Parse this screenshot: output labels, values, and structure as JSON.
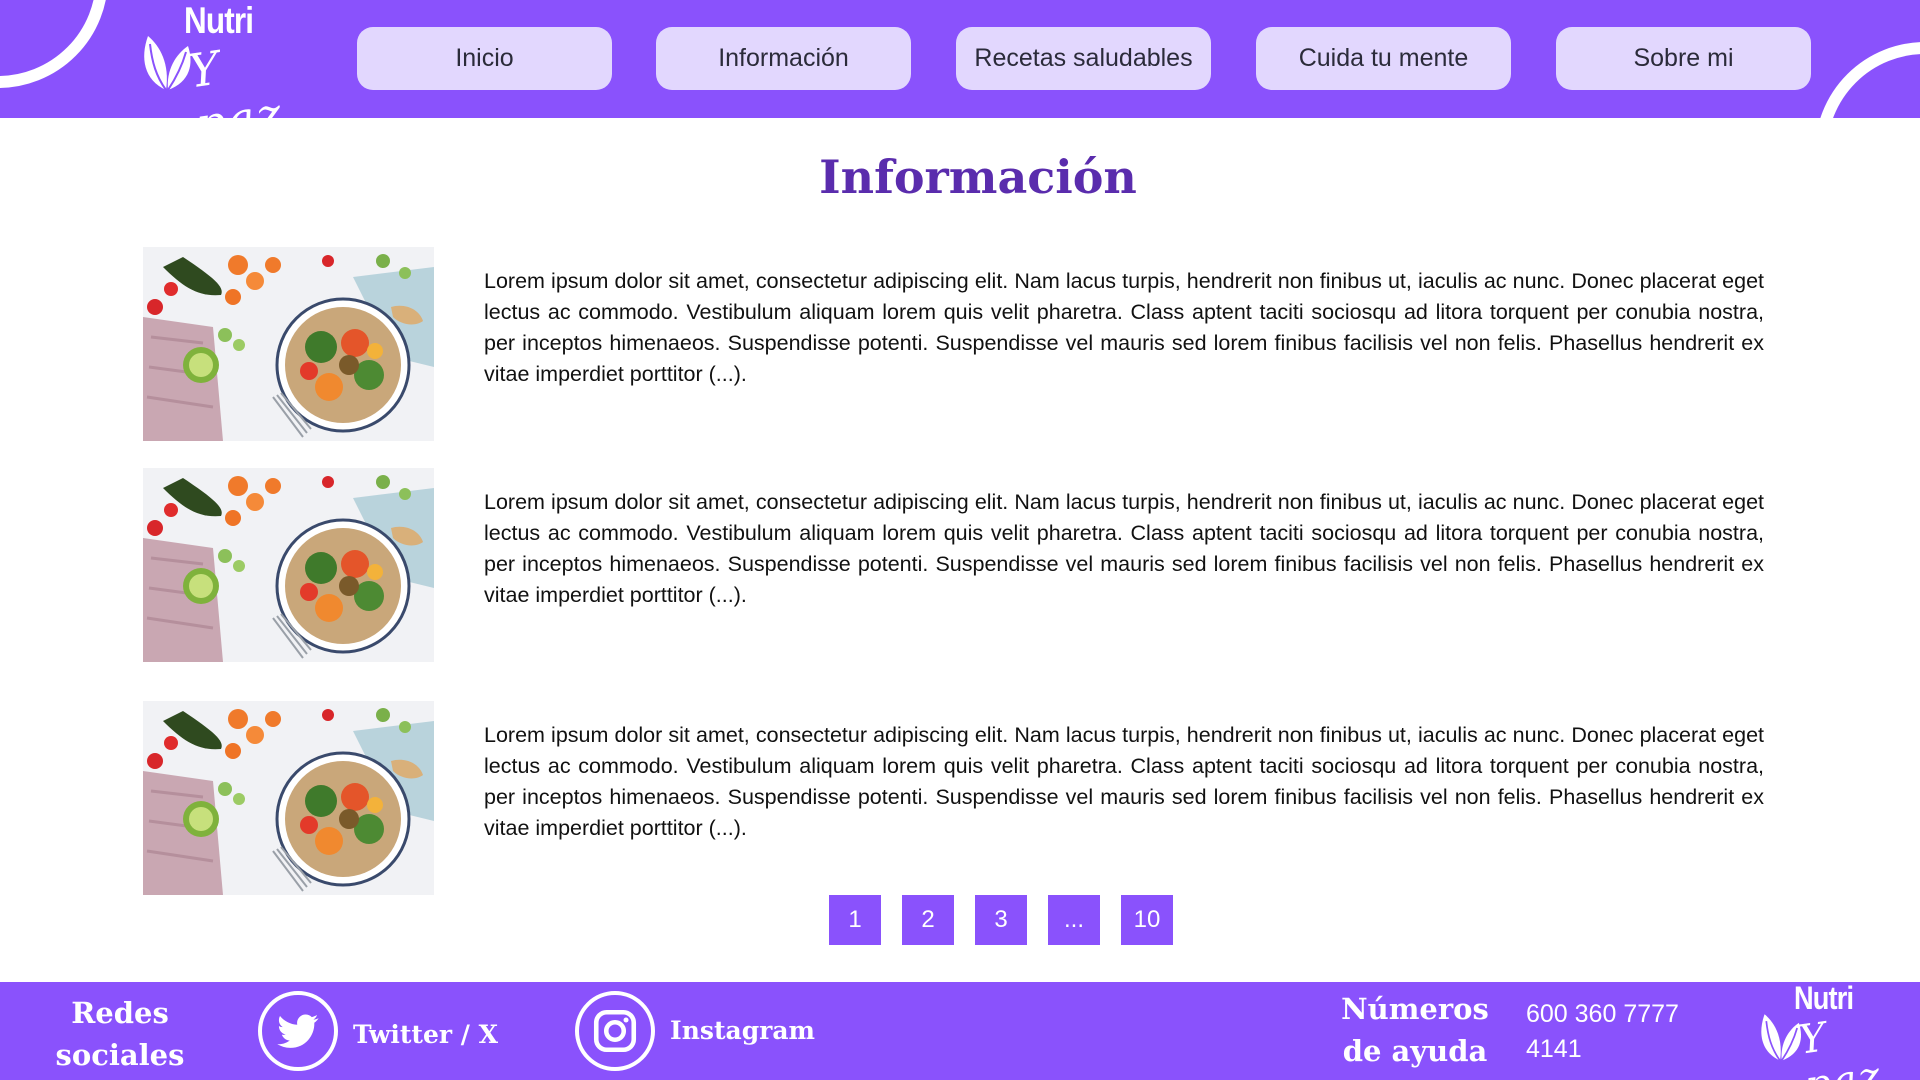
{
  "brand": {
    "name_top": "Nutri",
    "name_script": "Y paz",
    "accent": "#8a52fc",
    "nav_bg": "#e2d7fe",
    "title_color": "#5a2cad"
  },
  "nav": {
    "items": [
      {
        "label": "Inicio"
      },
      {
        "label": "Información"
      },
      {
        "label": "Recetas saludables"
      },
      {
        "label": "Cuida tu mente"
      },
      {
        "label": "Sobre mi"
      }
    ]
  },
  "main": {
    "title": "Información",
    "articles": [
      {
        "image": "healthy-food-bowl-photo",
        "text": "Lorem ipsum dolor sit amet, consectetur adipiscing elit. Nam lacus turpis, hendrerit non finibus ut, iaculis ac nunc. Donec placerat eget lectus ac commodo. Vestibulum aliquam lorem quis velit pharetra. Class aptent taciti sociosqu ad litora torquent per conubia nostra, per inceptos himenaeos. Suspendisse potenti. Suspendisse vel mauris sed lorem finibus facilisis vel non felis. Phasellus hendrerit ex vitae imperdiet porttitor (...)."
      },
      {
        "image": "healthy-food-bowl-photo",
        "text": "Lorem ipsum dolor sit amet, consectetur adipiscing elit. Nam lacus turpis, hendrerit non finibus ut, iaculis ac nunc. Donec placerat eget lectus ac commodo. Vestibulum aliquam lorem quis velit pharetra. Class aptent taciti sociosqu ad litora torquent per conubia nostra, per inceptos himenaeos. Suspendisse potenti. Suspendisse vel mauris sed lorem finibus facilisis vel non felis. Phasellus hendrerit ex vitae imperdiet porttitor (...)."
      },
      {
        "image": "healthy-food-bowl-photo",
        "text": "Lorem ipsum dolor sit amet, consectetur adipiscing elit. Nam lacus turpis, hendrerit non finibus ut, iaculis ac nunc. Donec placerat eget lectus ac commodo. Vestibulum aliquam lorem quis velit pharetra. Class aptent taciti sociosqu ad litora torquent per conubia nostra, per inceptos himenaeos. Suspendisse potenti. Suspendisse vel mauris sed lorem finibus facilisis vel non felis. Phasellus hendrerit ex vitae imperdiet porttitor (...)."
      }
    ],
    "pagination": [
      "1",
      "2",
      "3",
      "...",
      "10"
    ]
  },
  "footer": {
    "social_title": "Redes sociales",
    "twitter": {
      "icon": "twitter-bird-icon",
      "label": "Twitter / X"
    },
    "instagram": {
      "icon": "instagram-icon",
      "label": "Instagram"
    },
    "help_title": "Números de ayuda",
    "phones": [
      "600 360 7777",
      "4141"
    ]
  }
}
